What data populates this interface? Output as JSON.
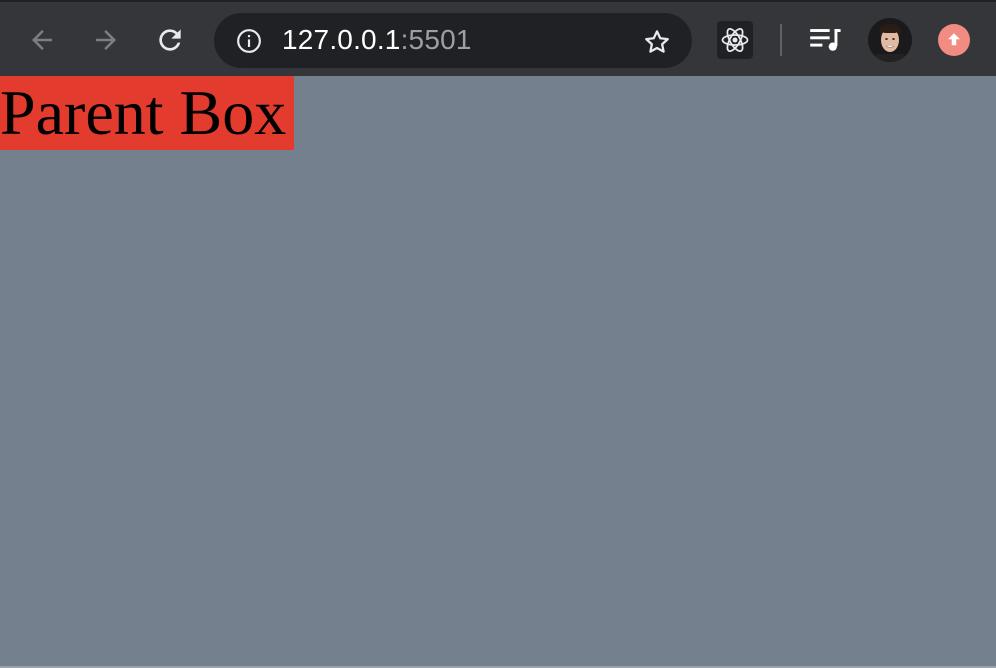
{
  "browser": {
    "url_host": "127.0.0.1",
    "url_port": ":5501",
    "icons": {
      "back": "arrow-left",
      "forward": "arrow-right",
      "reload": "reload",
      "site_info": "info-circle",
      "bookmark": "star-outline",
      "react_devtools": "react-atom",
      "media_controls": "playlist-music",
      "profile": "avatar",
      "update": "arrow-up-circle"
    },
    "colors": {
      "toolbar": "#35363a",
      "omnibox": "#202124",
      "update_badge": "#f28b82"
    }
  },
  "page": {
    "background": "#74808e",
    "parent_box": {
      "label": "Parent Box",
      "background": "#e33b2e"
    }
  }
}
